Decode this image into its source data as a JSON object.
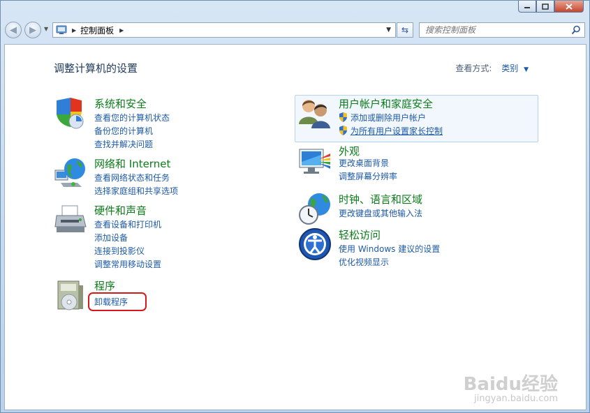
{
  "window": {
    "min_icon": "minimize-icon",
    "max_icon": "maximize-icon",
    "close_icon": "close-icon"
  },
  "toolbar": {
    "breadcrumb": "控制面板",
    "search_placeholder": "搜索控制面板"
  },
  "page": {
    "title": "调整计算机的设置",
    "view_label": "查看方式:",
    "view_value": "类别"
  },
  "categories": [
    {
      "title": "系统和安全",
      "icon": "shield-icon",
      "links": [
        "查看您的计算机状态",
        "备份您的计算机",
        "查找并解决问题"
      ]
    },
    {
      "title": "网络和 Internet",
      "icon": "network-globe-icon",
      "links": [
        "查看网络状态和任务",
        "选择家庭组和共享选项"
      ]
    },
    {
      "title": "硬件和声音",
      "icon": "printer-icon",
      "links": [
        "查看设备和打印机",
        "添加设备",
        "连接到投影仪",
        "调整常用移动设置"
      ]
    },
    {
      "title": "程序",
      "icon": "programs-icon",
      "links": [
        "卸载程序"
      ]
    },
    {
      "title": "用户帐户和家庭安全",
      "icon": "users-icon",
      "links": [
        "添加或删除用户帐户",
        "为所有用户设置家长控制"
      ]
    },
    {
      "title": "外观",
      "icon": "appearance-monitor-icon",
      "links": [
        "更改桌面背景",
        "调整屏幕分辨率"
      ]
    },
    {
      "title": "时钟、语言和区域",
      "icon": "clock-globe-icon",
      "links": [
        "更改键盘或其他输入法"
      ]
    },
    {
      "title": "轻松访问",
      "icon": "ease-of-access-icon",
      "links": [
        "使用 Windows 建议的设置",
        "优化视频显示"
      ]
    }
  ],
  "watermark": {
    "brand": "Baidu经验",
    "url": "jingyan.baidu.com"
  },
  "colors": {
    "category_title": "#0b7c19",
    "link": "#1d5aa6",
    "highlight": "#d4181c"
  }
}
